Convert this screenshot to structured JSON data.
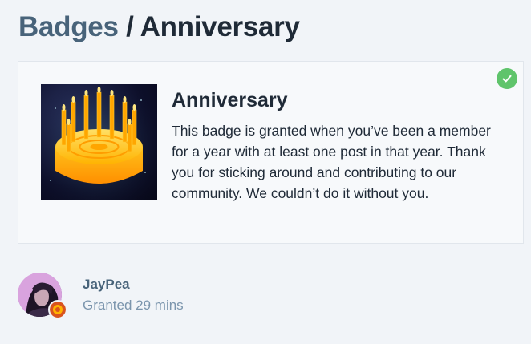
{
  "header": {
    "breadcrumb_link": "Badges",
    "separator": " / ",
    "current": "Anniversary"
  },
  "badge": {
    "name": "Anniversary",
    "description": "This badge is granted when you’ve been a member for a year with at least one post in that year. Thank you for sticking around and contributing to our community. We couldn’t do it without you.",
    "granted_icon": "check-icon",
    "image_icon": "birthday-cake-icon",
    "colors": {
      "check": "#5fc46b",
      "cake": "#ffb300",
      "background": "#0d0f2a"
    }
  },
  "grant": {
    "username": "JayPea",
    "granted_text": "Granted 29 mins",
    "avatar_icon": "user-avatar",
    "mini_badge_icon": "anniversary-badge-icon"
  }
}
